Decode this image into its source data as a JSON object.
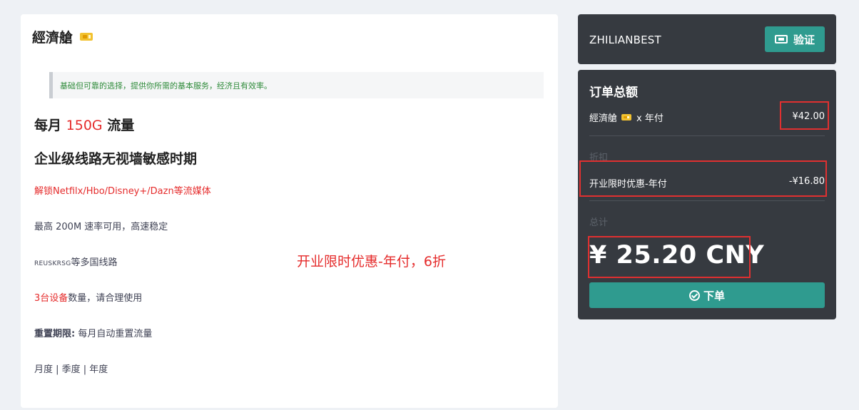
{
  "plan": {
    "name": "經濟艙",
    "description": "基础但可靠的选择，提供你所需的基本服务，经济且有效率。",
    "traffic_prefix": "每月",
    "traffic_amount": "150G",
    "traffic_suffix": "流量",
    "line_title": "企业级线路无视墙敏感时期",
    "unlock_media": "解锁Netfilx/Hbo/Disney+/Dazn等流媒体",
    "speed": "最高 200M 速率可用，高速稳定",
    "routes_tag": "REUSKRSG",
    "routes_suffix": "等多国线路",
    "devices_highlight": "3台设备",
    "devices_suffix": "数量，请合理使用",
    "reset_label": "重置期限:",
    "reset_value": "每月自动重置流量",
    "periods": "月度 | 季度 | 年度",
    "promo_note": "开业限时优惠-年付，6折"
  },
  "coupon": {
    "code": "ZHILIANBEST",
    "verify_label": "验证"
  },
  "order": {
    "title": "订单总额",
    "item_name": "經濟艙",
    "item_period": "x 年付",
    "item_price": "¥42.00",
    "discount_label": "折扣",
    "discount_name": "开业限时优惠-年付",
    "discount_value": "-¥16.80",
    "total_label": "总计",
    "total_amount": "¥ 25.20 CNY",
    "submit_label": "下单"
  },
  "colors": {
    "accent": "#2f9b8f",
    "dark_card": "#363a40",
    "highlight_red": "#e52b2b",
    "annotation_red": "#e03030"
  }
}
